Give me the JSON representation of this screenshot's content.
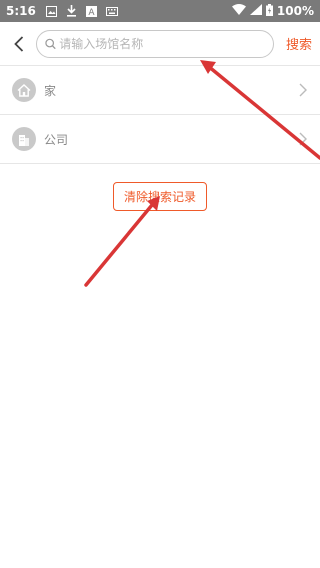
{
  "statusbar": {
    "time": "5:16",
    "battery": "100%",
    "icons": [
      "image-icon",
      "download-icon",
      "a-icon",
      "keyboard-icon",
      "wifi-icon",
      "signal-icon",
      "battery-icon"
    ]
  },
  "header": {
    "search_placeholder": "请输入场馆名称",
    "search_label": "搜索",
    "accent_color": "#ef5a2a"
  },
  "list": {
    "items": [
      {
        "label": "家",
        "icon": "home-icon"
      },
      {
        "label": "公司",
        "icon": "building-icon"
      }
    ]
  },
  "clear_label": "清除搜索记录",
  "annotation_color": "#d93636"
}
